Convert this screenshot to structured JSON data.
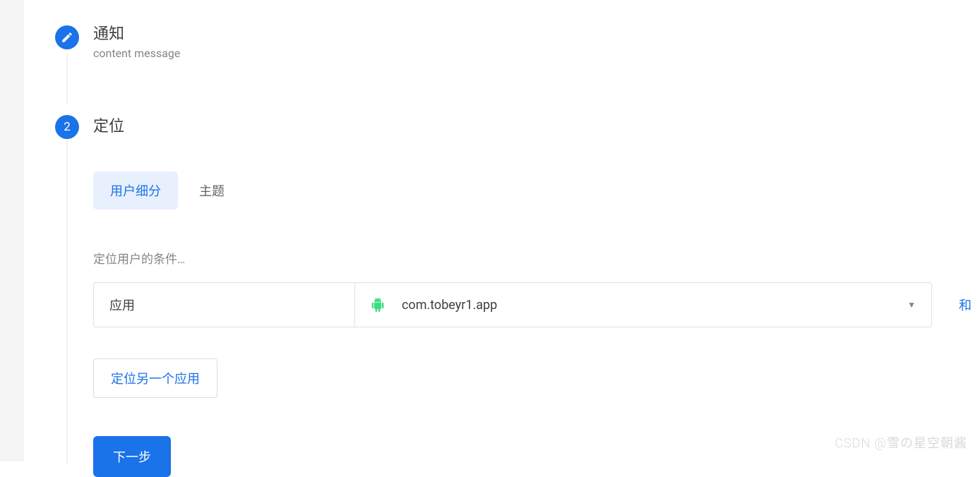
{
  "steps": {
    "s1": {
      "title": "通知",
      "subtitle": "content message"
    },
    "s2": {
      "number": "2",
      "title": "定位"
    }
  },
  "tabs": {
    "user_segment": "用户细分",
    "topic": "主题"
  },
  "condition": {
    "label": "定位用户的条件…",
    "app_label": "应用",
    "app_value": "com.tobeyr1.app",
    "and_label": "和"
  },
  "buttons": {
    "another_app": "定位另一个应用",
    "next": "下一步"
  },
  "watermark": "CSDN @雪の星空朝酱",
  "colors": {
    "primary": "#1a73e8",
    "primary_bg": "#e8f0fe"
  }
}
